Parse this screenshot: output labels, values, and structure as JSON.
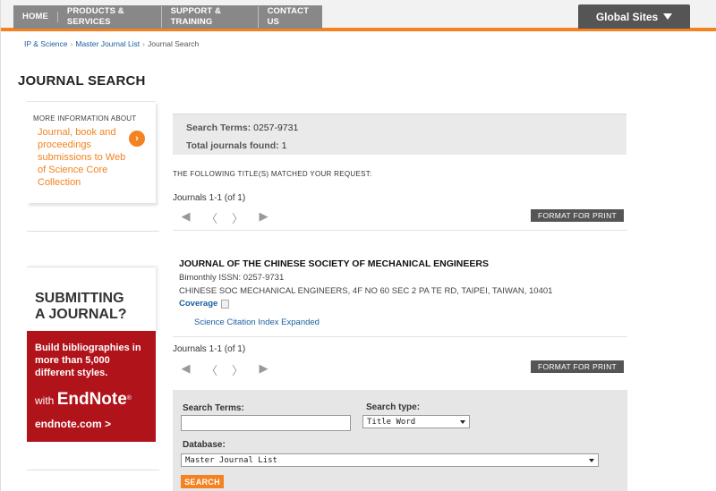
{
  "nav": {
    "items": [
      "HOME",
      "PRODUCTS & SERVICES",
      "SUPPORT & TRAINING",
      "CONTACT US"
    ],
    "global_sites": "Global Sites"
  },
  "breadcrumb": {
    "ip_science": "IP & Science",
    "master_list": "Master Journal List",
    "current": "Journal Search"
  },
  "page_title": "JOURNAL SEARCH",
  "sidebar": {
    "more_info_head": "MORE INFORMATION ABOUT",
    "more_info_link": "Journal, book and proceedings submissions to Web of Science Core Collection",
    "submit_title_1": "SUBMITTING",
    "submit_title_2": "A JOURNAL?",
    "endnote_text": "Build bibliographies in more than 5,000 different styles.",
    "endnote_with": "with",
    "endnote_brand": "EndNote",
    "endnote_reg": "®",
    "endnote_url": "endnote.com  >"
  },
  "summary": {
    "terms_label": "Search Terms:",
    "terms_value": "0257-9731",
    "total_label": "Total journals found:",
    "total_value": "1"
  },
  "matched_text": "THE FOLLOWING TITLE(S) MATCHED YOUR REQUEST:",
  "pager": {
    "label": "Journals 1-1 (of 1)",
    "first": "◀",
    "prev": "〈",
    "next": "〉",
    "last": "▶",
    "format_print": "FORMAT FOR PRINT"
  },
  "journal": {
    "title": "JOURNAL OF THE CHINESE SOCIETY OF MECHANICAL ENGINEERS",
    "issn_line": "Bimonthly ISSN: 0257-9731",
    "address": "CHINESE SOC MECHANICAL ENGINEERS, 4F NO 60 SEC 2 PA TE RD, TAIPEI, TAIWAN, 10401",
    "coverage": "Coverage",
    "index": "Science Citation Index Expanded"
  },
  "search_form": {
    "terms_label": "Search Terms:",
    "terms_value": "",
    "type_label": "Search type:",
    "type_value": "Title Word",
    "db_label": "Database:",
    "db_value": "Master Journal List",
    "search_button": "SEARCH"
  },
  "colors": {
    "accent_orange": "#f58220",
    "endnote_red": "#b0131a",
    "link_blue": "#1a5fa0"
  }
}
